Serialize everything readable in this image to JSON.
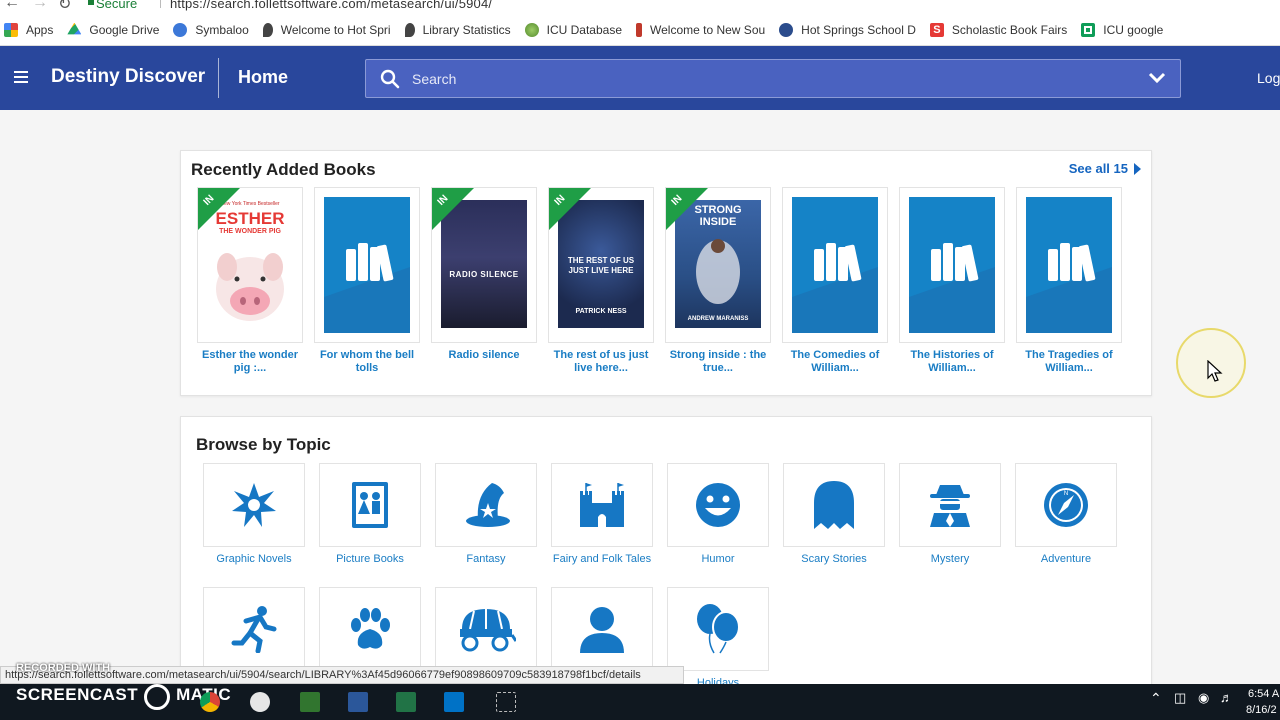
{
  "browser": {
    "secure_label": "Secure",
    "url": "https://search.follettsoftware.com/metasearch/ui/5904/",
    "bookmarks": [
      {
        "label": "Apps",
        "color": "#e0443e"
      },
      {
        "label": "Google Drive",
        "color": "#1fa463"
      },
      {
        "label": "Symbaloo",
        "color": "#3c78d8"
      },
      {
        "label": "Welcome to Hot Spri",
        "color": "#555555"
      },
      {
        "label": "Library Statistics",
        "color": "#555555"
      },
      {
        "label": "ICU Database",
        "color": "#6a8e3b"
      },
      {
        "label": "Welcome to New Sou",
        "color": "#c0392b"
      },
      {
        "label": "Hot Springs School D",
        "color": "#2b4c8c"
      },
      {
        "label": "Scholastic Book Fairs",
        "color": "#e53935"
      },
      {
        "label": "ICU google",
        "color": "#0f9d58"
      }
    ]
  },
  "header": {
    "brand": "Destiny Discover",
    "home": "Home",
    "search_placeholder": "Search",
    "login": "Log"
  },
  "recent": {
    "title": "Recently Added Books",
    "see_all": "See all 15",
    "in_label": "IN",
    "books": [
      {
        "title": "Esther the wonder pig :...",
        "cover": "esther",
        "available": true
      },
      {
        "title": "For whom the bell tolls",
        "cover": "generic",
        "available": false
      },
      {
        "title": "Radio silence",
        "cover": "radio",
        "available": true
      },
      {
        "title": "The rest of us just live here...",
        "cover": "rest",
        "available": true
      },
      {
        "title": "Strong inside : the true...",
        "cover": "strong",
        "available": true
      },
      {
        "title": "The Comedies of William...",
        "cover": "generic",
        "available": false
      },
      {
        "title": "The Histories of William...",
        "cover": "generic",
        "available": false
      },
      {
        "title": "The Tragedies of William...",
        "cover": "generic",
        "available": false
      }
    ],
    "covers": {
      "esther_top": "New York Times Bestseller",
      "esther_title": "ESTHER",
      "esther_sub": "THE WONDER PIG",
      "radio_title": "RADIO SILENCE",
      "rest_title": "THE REST OF US JUST LIVE HERE",
      "rest_author": "PATRICK NESS",
      "strong_title": "STRONG INSIDE",
      "strong_author": "ANDREW MARANISS"
    }
  },
  "browse": {
    "title": "Browse by Topic",
    "topics": [
      {
        "label": "Graphic Novels",
        "icon": "burst-icon"
      },
      {
        "label": "Picture Books",
        "icon": "picture-book-icon"
      },
      {
        "label": "Fantasy",
        "icon": "wizard-hat-icon"
      },
      {
        "label": "Fairy and Folk Tales",
        "icon": "castle-icon"
      },
      {
        "label": "Humor",
        "icon": "smiley-icon"
      },
      {
        "label": "Scary Stories",
        "icon": "ghost-icon"
      },
      {
        "label": "Mystery",
        "icon": "detective-icon"
      },
      {
        "label": "Adventure",
        "icon": "compass-icon"
      },
      {
        "label": "",
        "icon": "runner-icon"
      },
      {
        "label": "",
        "icon": "paw-icon"
      },
      {
        "label": "",
        "icon": "wagon-icon"
      },
      {
        "label": "",
        "icon": "person-icon"
      },
      {
        "label": "Holidays",
        "icon": "balloons-icon"
      }
    ]
  },
  "status": {
    "hover_url": "https://search.follettsoftware.com/metasearch/ui/5904/search/LIBRARY%3Af45d96066779ef90898609709c583918798f1bcf/details"
  },
  "watermark": {
    "small": "RECORDED WITH",
    "left": "SCREENCAST",
    "right": "MATIC"
  },
  "taskbar": {
    "time": "6:54 A",
    "date": "8/16/2"
  },
  "colors": {
    "header": "#29479c",
    "link": "#1a7dc4",
    "ribbon": "#1f9e46",
    "icon": "#1677c4"
  }
}
